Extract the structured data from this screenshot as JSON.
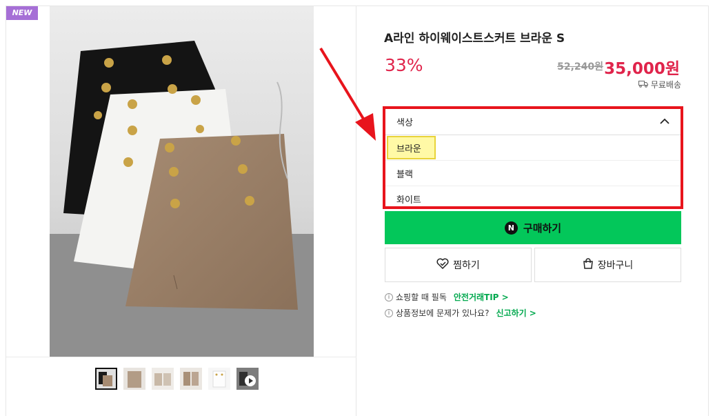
{
  "product": {
    "badge": "NEW",
    "title": "A라인 하이웨이스트스커트 브라운 S",
    "discount": "33%",
    "original_price": "52,240원",
    "price": "35,000원",
    "shipping": "무료배송"
  },
  "option": {
    "label": "색상",
    "options": [
      "브라운",
      "블랙",
      "화이트"
    ],
    "highlighted": "브라운"
  },
  "buttons": {
    "buy": "구매하기",
    "buy_icon": "N",
    "wish": "찜하기",
    "cart": "장바구니"
  },
  "info": {
    "line1_text": "쇼핑할 때 필독",
    "line1_link": "안전거래TIP >",
    "line2_text": "상품정보에 문제가 있나요?",
    "line2_link": "신고하기 >"
  },
  "icons": [
    "chevron-up-icon",
    "truck-icon",
    "heart-check-icon",
    "shopping-bag-icon",
    "info-icon",
    "play-icon"
  ],
  "colors": {
    "accent_red": "#e0244b",
    "buy_green": "#03c75a",
    "link_green": "#03a94f",
    "annotation_red": "#e8141c"
  }
}
